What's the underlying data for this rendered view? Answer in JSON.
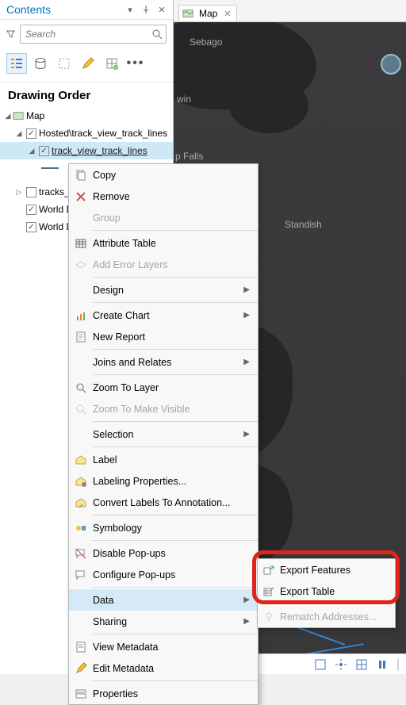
{
  "panel": {
    "title": "Contents",
    "search_placeholder": "Search",
    "section": "Drawing Order"
  },
  "tree": {
    "map": "Map",
    "hosted": "Hosted\\track_view_track_lines",
    "layer_selected": "track_view_track_lines",
    "tracks_v": "tracks_v",
    "world_d1": "World D",
    "world_d2": "World D"
  },
  "tab": {
    "label": "Map"
  },
  "map_labels": {
    "sebago": "Sebago",
    "win": "win",
    "falls": "p Falls",
    "standish": "Standish"
  },
  "ctx": {
    "copy": "Copy",
    "remove": "Remove",
    "group": "Group",
    "attribute_table": "Attribute Table",
    "add_error": "Add Error Layers",
    "design": "Design",
    "create_chart": "Create Chart",
    "new_report": "New Report",
    "joins": "Joins and Relates",
    "zoom_layer": "Zoom To Layer",
    "zoom_visible": "Zoom To Make Visible",
    "selection": "Selection",
    "label": "Label",
    "labeling_props": "Labeling Properties...",
    "convert_labels": "Convert Labels To Annotation...",
    "symbology": "Symbology",
    "disable_popups": "Disable Pop-ups",
    "configure_popups": "Configure Pop-ups",
    "data": "Data",
    "sharing": "Sharing",
    "view_meta": "View Metadata",
    "edit_meta": "Edit Metadata",
    "properties": "Properties"
  },
  "submenu": {
    "export_features": "Export Features",
    "export_table": "Export Table",
    "rematch": "Rematch Addresses..."
  }
}
